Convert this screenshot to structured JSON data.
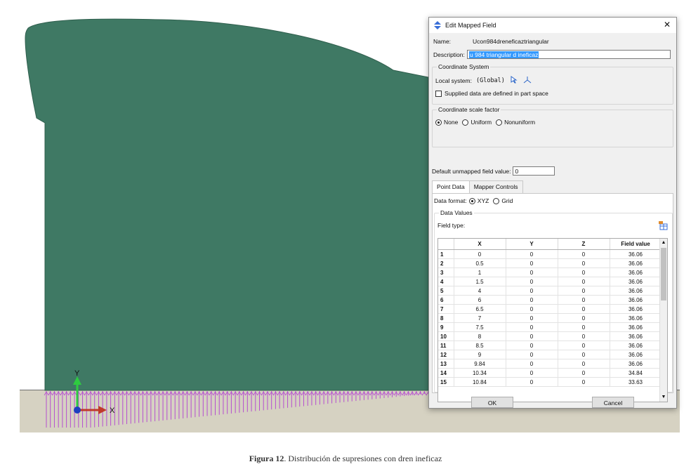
{
  "colors": {
    "dam_fill": "#3f7964",
    "ground": "#d6d2c2",
    "arrows": "#b64fd0",
    "axis_x": "#c0392b",
    "axis_y": "#2ecc40",
    "axis_origin": "#1f3fbf"
  },
  "axes": {
    "x_label": "X",
    "y_label": "Y"
  },
  "dialog": {
    "title": "Edit Mapped Field",
    "title_icon": "mapped-field-icon",
    "close_glyph": "✕",
    "name_label": "Name:",
    "name_value": "Ucon984dreneficaztriangular",
    "description_label": "Description:",
    "description_value": "u 984 triangular d ineficaz",
    "coord_group_title": "Coordinate System",
    "local_system_label": "Local system:",
    "local_system_value": "(Global)",
    "supplied_label": "Supplied data are defined in part space",
    "scale_group_title": "Coordinate scale factor",
    "scale_options": [
      "None",
      "Uniform",
      "Nonuniform"
    ],
    "default_label": "Default unmapped field value:",
    "default_value": "0",
    "tabs": [
      "Point Data",
      "Mapper Controls"
    ],
    "data_format_label": "Data format:",
    "format_options": [
      "XYZ",
      "Grid"
    ],
    "data_values_title": "Data Values",
    "field_type_label": "Field type:",
    "table": {
      "headers": [
        "X",
        "Y",
        "Z",
        "Field value"
      ],
      "rows": [
        [
          "1",
          "0",
          "0",
          "0",
          "36.06"
        ],
        [
          "2",
          "0.5",
          "0",
          "0",
          "36.06"
        ],
        [
          "3",
          "1",
          "0",
          "0",
          "36.06"
        ],
        [
          "4",
          "1.5",
          "0",
          "0",
          "36.06"
        ],
        [
          "5",
          "4",
          "0",
          "0",
          "36.06"
        ],
        [
          "6",
          "6",
          "0",
          "0",
          "36.06"
        ],
        [
          "7",
          "6.5",
          "0",
          "0",
          "36.06"
        ],
        [
          "8",
          "7",
          "0",
          "0",
          "36.06"
        ],
        [
          "9",
          "7.5",
          "0",
          "0",
          "36.06"
        ],
        [
          "10",
          "8",
          "0",
          "0",
          "36.06"
        ],
        [
          "11",
          "8.5",
          "0",
          "0",
          "36.06"
        ],
        [
          "12",
          "9",
          "0",
          "0",
          "36.06"
        ],
        [
          "13",
          "9.84",
          "0",
          "0",
          "36.06"
        ],
        [
          "14",
          "10.34",
          "0",
          "0",
          "34.84"
        ],
        [
          "15",
          "10.84",
          "0",
          "0",
          "33.63"
        ]
      ]
    },
    "ok_label": "OK",
    "cancel_label": "Cancel"
  },
  "caption": {
    "label": "Figura 12",
    "text": ". Distribución de supresiones con dren ineficaz"
  }
}
